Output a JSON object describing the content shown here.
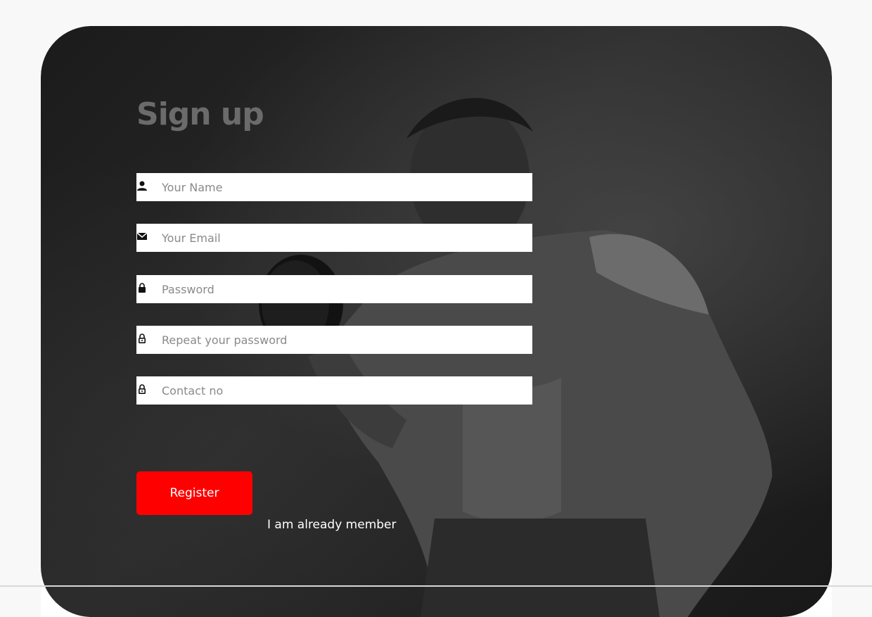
{
  "form": {
    "title": "Sign up",
    "fields": [
      {
        "icon": "person-icon",
        "placeholder": "Your Name",
        "value": ""
      },
      {
        "icon": "mail-icon",
        "placeholder": "Your Email",
        "value": ""
      },
      {
        "icon": "lock-icon",
        "placeholder": "Password",
        "value": ""
      },
      {
        "icon": "lock-outline-icon",
        "placeholder": "Repeat your password",
        "value": ""
      },
      {
        "icon": "lock-outline-icon",
        "placeholder": "Contact no",
        "value": ""
      }
    ],
    "register_label": "Register",
    "member_link": "I am already member"
  },
  "colors": {
    "accent": "#ff0000",
    "title": "#6b6b6b",
    "background": "#f8f8f8"
  }
}
